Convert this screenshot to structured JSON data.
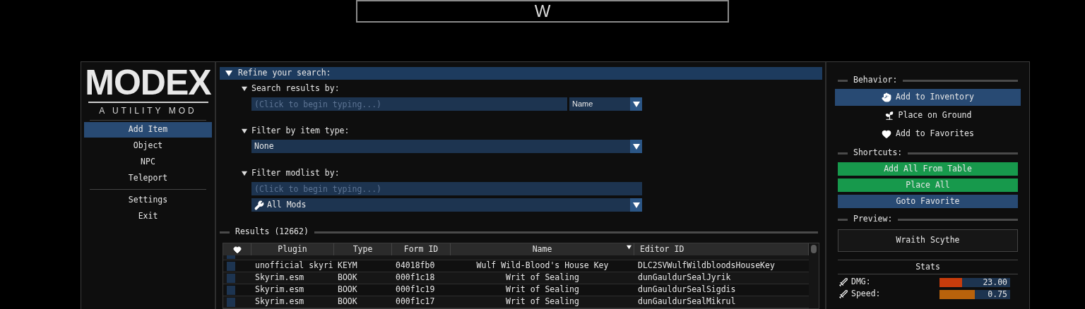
{
  "banner": {
    "title": "W"
  },
  "sidebar": {
    "logo": {
      "title": "MODEX",
      "subtitle": "A UTILITY MOD"
    },
    "nav": [
      {
        "label": "Add Item",
        "selected": true
      },
      {
        "label": "Object",
        "selected": false
      },
      {
        "label": "NPC",
        "selected": false
      },
      {
        "label": "Teleport",
        "selected": false
      }
    ],
    "system": [
      {
        "label": "Settings",
        "selected": false
      },
      {
        "label": "Exit",
        "selected": false
      }
    ]
  },
  "search": {
    "title": "Refine your search:",
    "expanded": true,
    "sections": [
      {
        "kind": "search",
        "title": "Search results by:",
        "expanded": true,
        "placeholder": "(Click to begin typing...)",
        "dropdown": "Name"
      },
      {
        "kind": "dropdown",
        "title": "Filter by item type:",
        "expanded": true,
        "dropdown": "None"
      },
      {
        "kind": "modlist",
        "title": "Filter modlist by:",
        "expanded": true,
        "placeholder": "(Click to begin typing...)",
        "dropdown": "All Mods"
      }
    ]
  },
  "results": {
    "title": "Results (12662)",
    "columns": [
      {
        "label": "Plugin",
        "sorted": false
      },
      {
        "label": "Type",
        "sorted": false
      },
      {
        "label": "Form ID",
        "sorted": false
      },
      {
        "label": "Name",
        "sorted": true
      },
      {
        "label": "Editor ID",
        "sorted": false
      }
    ],
    "rows": [
      {
        "favorite": false,
        "cells": [
          "unofficial skyri",
          "KEYM",
          "04018fb0",
          "Wulf Wild-Blood's House Key",
          "DLC2SVWulfWildbloodsHouseKey"
        ]
      },
      {
        "favorite": false,
        "cells": [
          "Skyrim.esm",
          "BOOK",
          "000f1c18",
          "Writ of Sealing",
          "dunGauldurSealJyrik"
        ]
      },
      {
        "favorite": false,
        "cells": [
          "Skyrim.esm",
          "BOOK",
          "000f1c19",
          "Writ of Sealing",
          "dunGauldurSealSigdis"
        ]
      },
      {
        "favorite": false,
        "cells": [
          "Skyrim.esm",
          "BOOK",
          "000f1c17",
          "Writ of Sealing",
          "dunGauldurSealMikrul"
        ]
      }
    ]
  },
  "panel": {
    "behavior": {
      "title": "Behavior:",
      "options": [
        {
          "label": "Add to Inventory",
          "selected": true
        },
        {
          "label": "Place on Ground",
          "selected": false
        },
        {
          "label": "Add to Favorites",
          "selected": false
        }
      ]
    },
    "shortcuts": {
      "title": "Shortcuts:",
      "buttons": [
        {
          "label": "Add All From Table",
          "color": "#17994c"
        },
        {
          "label": "Place All",
          "color": "#17994c"
        },
        {
          "label": "Goto Favorite",
          "color": "#284a73"
        }
      ]
    },
    "preview": {
      "title": "Preview:",
      "item": "Wraith Scythe"
    },
    "stats": {
      "title": "Stats",
      "items": [
        {
          "label": "DMG:",
          "value": "23.00",
          "level": 0.32,
          "color": "#c83c0c"
        },
        {
          "label": "Speed:",
          "value": "0.75",
          "level": 0.5,
          "color": "#b8620c"
        }
      ]
    }
  }
}
